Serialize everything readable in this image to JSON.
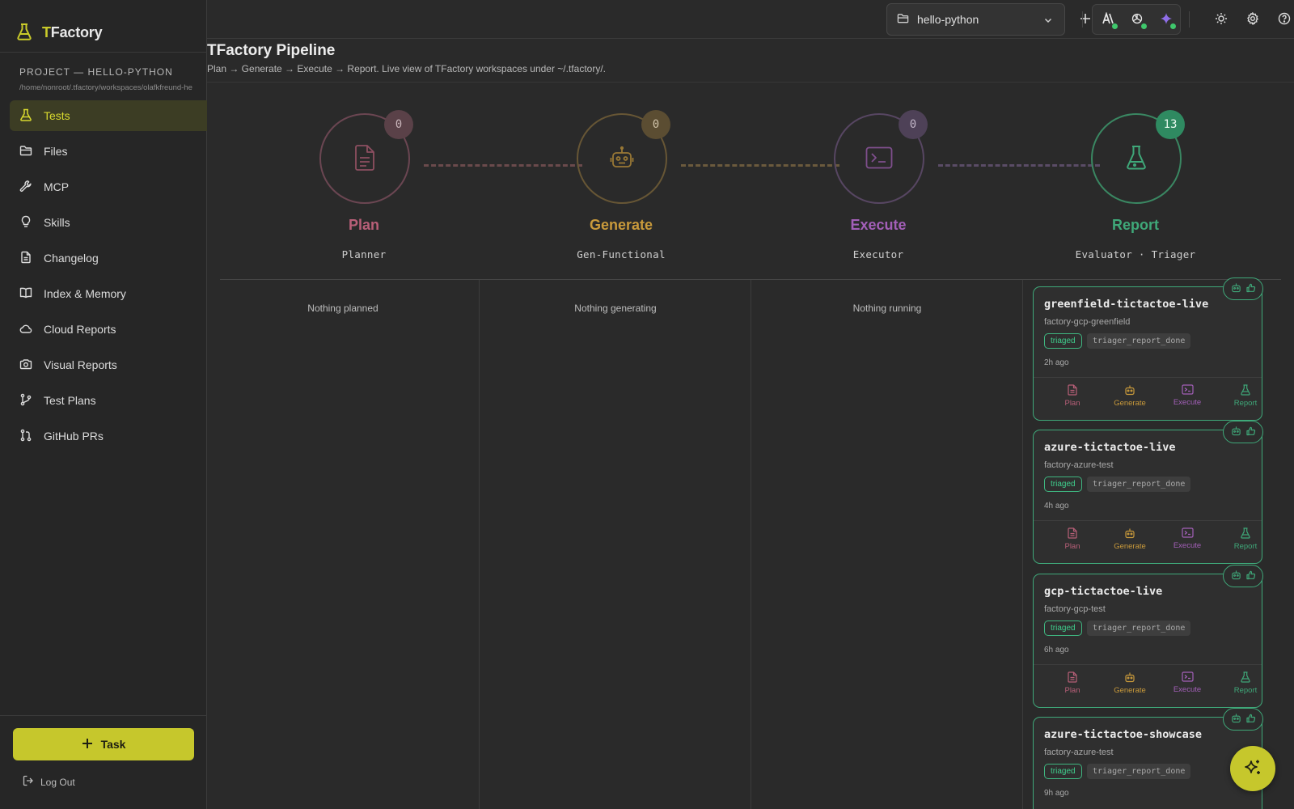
{
  "app": {
    "brand_first": "T",
    "brand_rest": "Factory"
  },
  "sidebar": {
    "project_title": "PROJECT — HELLO-PYTHON",
    "project_path": "/home/nonroot/.tfactory/workspaces/olafkfreund-he",
    "items": [
      {
        "label": "Tests",
        "icon": "flask-icon",
        "active": true
      },
      {
        "label": "Files",
        "icon": "folder-icon"
      },
      {
        "label": "MCP",
        "icon": "wrench-icon"
      },
      {
        "label": "Skills",
        "icon": "lightbulb-icon"
      },
      {
        "label": "Changelog",
        "icon": "document-icon"
      },
      {
        "label": "Index & Memory",
        "icon": "book-icon"
      },
      {
        "label": "Cloud Reports",
        "icon": "cloud-icon"
      },
      {
        "label": "Visual Reports",
        "icon": "camera-icon"
      },
      {
        "label": "Test Plans",
        "icon": "git-branch-icon"
      },
      {
        "label": "GitHub PRs",
        "icon": "git-pull-request-icon"
      }
    ],
    "task_label": "Task",
    "logout_label": "Log Out"
  },
  "topbar": {
    "project_value": "hello-python"
  },
  "header": {
    "title": "TFactory Pipeline",
    "subtitle": "Plan → Generate → Execute → Report. Live view of TFactory workspaces under ~/.tfactory/."
  },
  "stages": [
    {
      "name": "Plan",
      "role": "Planner",
      "count": "0",
      "color": "#b85f78",
      "icon": "document-icon"
    },
    {
      "name": "Generate",
      "role": "Gen-Functional",
      "count": "0",
      "color": "#c99a3b",
      "icon": "robot-icon"
    },
    {
      "name": "Execute",
      "role": "Executor",
      "count": "0",
      "color": "#a35fb8",
      "icon": "terminal-icon"
    },
    {
      "name": "Report",
      "role": "Evaluator · Triager",
      "count": "13",
      "color": "#3fa879",
      "icon": "flask-icon"
    }
  ],
  "columns": {
    "plan_empty": "Nothing planned",
    "generate_empty": "Nothing generating",
    "execute_empty": "Nothing running"
  },
  "cards": [
    {
      "name": "greenfield-tictactoe-live",
      "sub": "factory-gcp-greenfield",
      "badge": "triaged",
      "status": "triager_report_done",
      "time": "2h ago"
    },
    {
      "name": "azure-tictactoe-live",
      "sub": "factory-azure-test",
      "badge": "triaged",
      "status": "triager_report_done",
      "time": "4h ago"
    },
    {
      "name": "gcp-tictactoe-live",
      "sub": "factory-gcp-test",
      "badge": "triaged",
      "status": "triager_report_done",
      "time": "6h ago"
    },
    {
      "name": "azure-tictactoe-showcase",
      "sub": "factory-azure-test",
      "badge": "triaged",
      "status": "triager_report_done",
      "time": "9h ago"
    }
  ],
  "card_actions": [
    "Plan",
    "Generate",
    "Execute",
    "Report"
  ],
  "colors": {
    "accent": "#c6c72c",
    "plan": "#b85f78",
    "generate": "#c99a3b",
    "execute": "#a35fb8",
    "report": "#3fa879"
  }
}
